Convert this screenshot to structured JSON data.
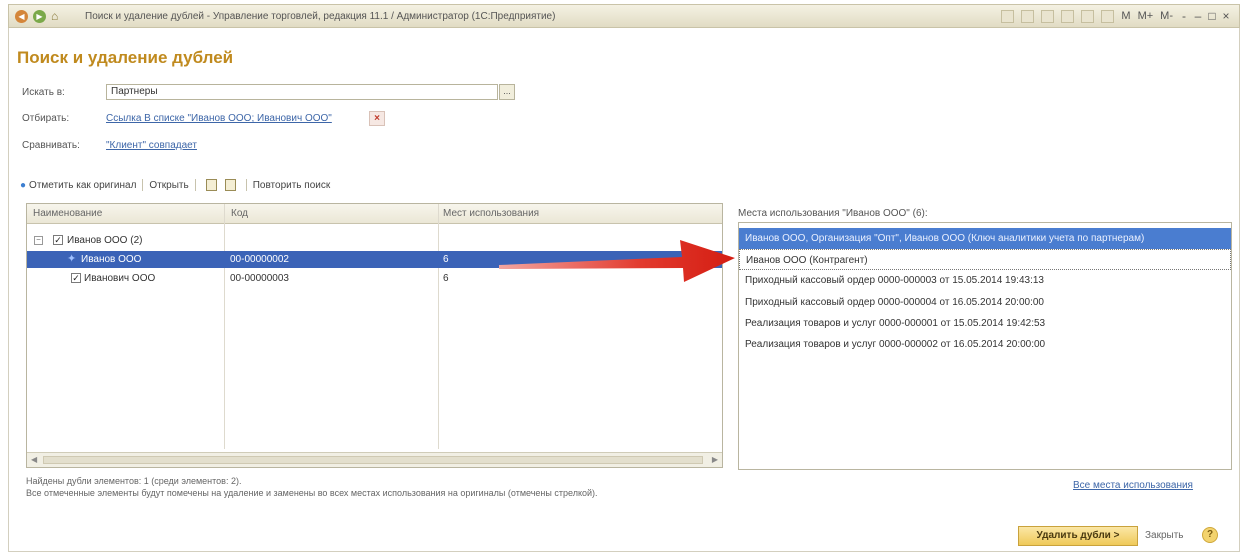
{
  "window": {
    "title": "Поиск и удаление дублей - Управление торговлей, редакция 11.1 / Администратор  (1С:Предприятие)",
    "tools_m": [
      "M",
      "M+",
      "M-"
    ],
    "win_controls": [
      "-",
      "–",
      "□",
      "×"
    ]
  },
  "page": {
    "title": "Поиск и удаление дублей"
  },
  "filters": {
    "search_in_label": "Искать в:",
    "search_in_value": "Партнеры",
    "select_button": "...",
    "filter_label": "Отбирать:",
    "filter_link": "Ссылка В списке \"Иванов ООО; Иванович ООО\"",
    "compare_label": "Сравнивать:",
    "compare_link": "\"Клиент\" совпадает"
  },
  "toolbar": {
    "mark_original": "Отметить как оригинал",
    "open": "Открыть",
    "repeat_search": "Повторить поиск"
  },
  "grid": {
    "columns": [
      "Наименование",
      "Код",
      "Мест использования"
    ],
    "rows": [
      {
        "name": "Иванов ООО (2)",
        "code": "",
        "count": "",
        "group": true,
        "checked": true
      },
      {
        "name": "Иванов ООО",
        "code": "00-00000002",
        "count": "6",
        "original": true,
        "selected": true
      },
      {
        "name": "Иванович ООО",
        "code": "00-00000003",
        "count": "6",
        "checked": true
      }
    ]
  },
  "places": {
    "title": "Места использования \"Иванов ООО\" (6):",
    "items": [
      "Иванов ООО, Организация \"Опт\", Иванов ООО (Ключ аналитики учета по партнерам)",
      "Иванов ООО (Контрагент)",
      "Приходный кассовый ордер 0000-000003 от 15.05.2014 19:43:13",
      "Приходный кассовый ордер 0000-000004 от 16.05.2014 20:00:00",
      "Реализация товаров и услуг 0000-000001 от 15.05.2014 19:42:53",
      "Реализация товаров и услуг 0000-000002 от 16.05.2014 20:00:00"
    ]
  },
  "footer": {
    "found_text": "Найдены дубли элементов: 1 (среди элементов: 2).",
    "note_text": "Все отмеченные элементы будут помечены на удаление и заменены во всех местах использования на оригиналы (отмечены стрелкой).",
    "all_places_link": "Все места использования",
    "delete_button": "Удалить дубли >",
    "close_button": "Закрыть",
    "help_button": "?"
  },
  "colors": {
    "accent_title": "#c08a1e",
    "selection": "#3b63b7",
    "link": "#3d66a8",
    "arrow": "#e0251c"
  },
  "icons": [
    "back-icon",
    "forward-icon",
    "home-icon",
    "mark-original-icon",
    "copy-icon",
    "paste-icon",
    "original-star-icon",
    "close-icon",
    "help-icon"
  ]
}
